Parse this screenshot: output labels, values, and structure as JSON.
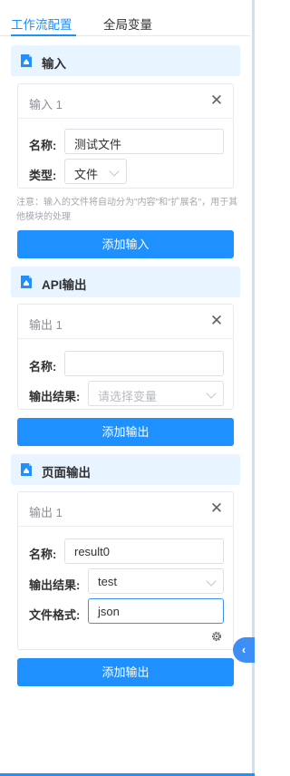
{
  "tabs": [
    "工作流配置",
    "全局变量"
  ],
  "sections": {
    "input": {
      "title": "输入",
      "card_title": "输入 1",
      "name_label": "名称:",
      "name_value": "测试文件",
      "type_label": "类型:",
      "type_value": "文件",
      "note": "注意：输入的文件将自动分为\"内容\"和\"扩展名\"，用于其他模块的处理",
      "add_button": "添加输入"
    },
    "api_output": {
      "title": "API输出",
      "card_title": "输出 1",
      "name_label": "名称:",
      "name_value": "",
      "result_label": "输出结果:",
      "result_placeholder": "请选择变量",
      "add_button": "添加输出"
    },
    "page_output": {
      "title": "页面输出",
      "card_title": "输出 1",
      "name_label": "名称:",
      "name_value": "result0",
      "result_label": "输出结果:",
      "result_value": "test",
      "format_label": "文件格式:",
      "format_value": "json",
      "add_button": "添加输出"
    }
  },
  "icons": {
    "section": "file-icon",
    "close": "close-icon",
    "settings": "gear-icon",
    "collapse": "chevron-left-icon"
  },
  "colors": {
    "accent": "#1e90ff",
    "section_bg": "#e8f4ff"
  }
}
